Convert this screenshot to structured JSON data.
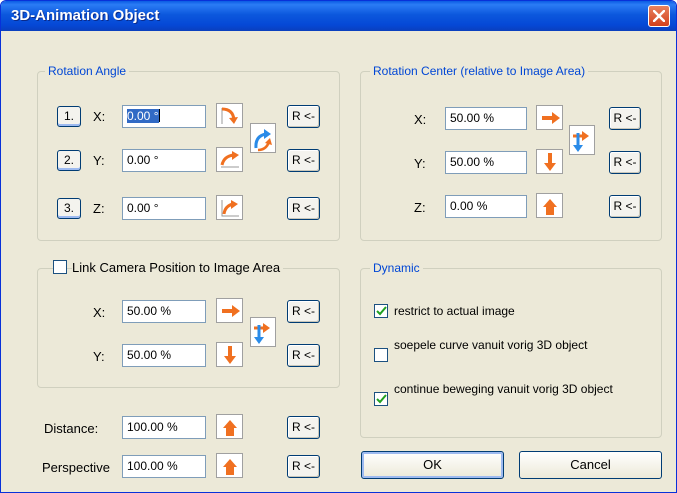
{
  "window": {
    "title": "3D-Animation Object"
  },
  "rotation_angle": {
    "legend": "Rotation Angle",
    "rows": [
      {
        "num": "1.",
        "axis": "X:",
        "value": "0.00 °"
      },
      {
        "num": "2.",
        "axis": "Y:",
        "value": "0.00 °"
      },
      {
        "num": "3.",
        "axis": "Z:",
        "value": "0.00 °"
      }
    ]
  },
  "rotation_center": {
    "legend": "Rotation Center (relative to Image Area)",
    "rows": [
      {
        "axis": "X:",
        "value": "50.00 %"
      },
      {
        "axis": "Y:",
        "value": "50.00 %"
      },
      {
        "axis": "Z:",
        "value": "0.00 %"
      }
    ]
  },
  "camera": {
    "checkbox_label": "Link Camera Position to Image Area",
    "checked": false,
    "rows": [
      {
        "axis": "X:",
        "value": "50.00 %"
      },
      {
        "axis": "Y:",
        "value": "50.00 %"
      }
    ]
  },
  "distance": {
    "label": "Distance:",
    "value": "100.00 %"
  },
  "perspective": {
    "label": "Perspective",
    "value": "100.00 %"
  },
  "dynamic": {
    "legend": "Dynamic",
    "options": [
      {
        "label": "restrict to actual image",
        "checked": true
      },
      {
        "label": "soepele curve vanuit vorig 3D object",
        "checked": false
      },
      {
        "label": "continue beweging vanuit vorig 3D object",
        "checked": true
      }
    ]
  },
  "reset_label": "R <-",
  "buttons": {
    "ok": "OK",
    "cancel": "Cancel"
  },
  "colors": {
    "accent_orange": "#f07020",
    "arrow_blue": "#2a8be8",
    "legend_blue": "#0046d5"
  }
}
